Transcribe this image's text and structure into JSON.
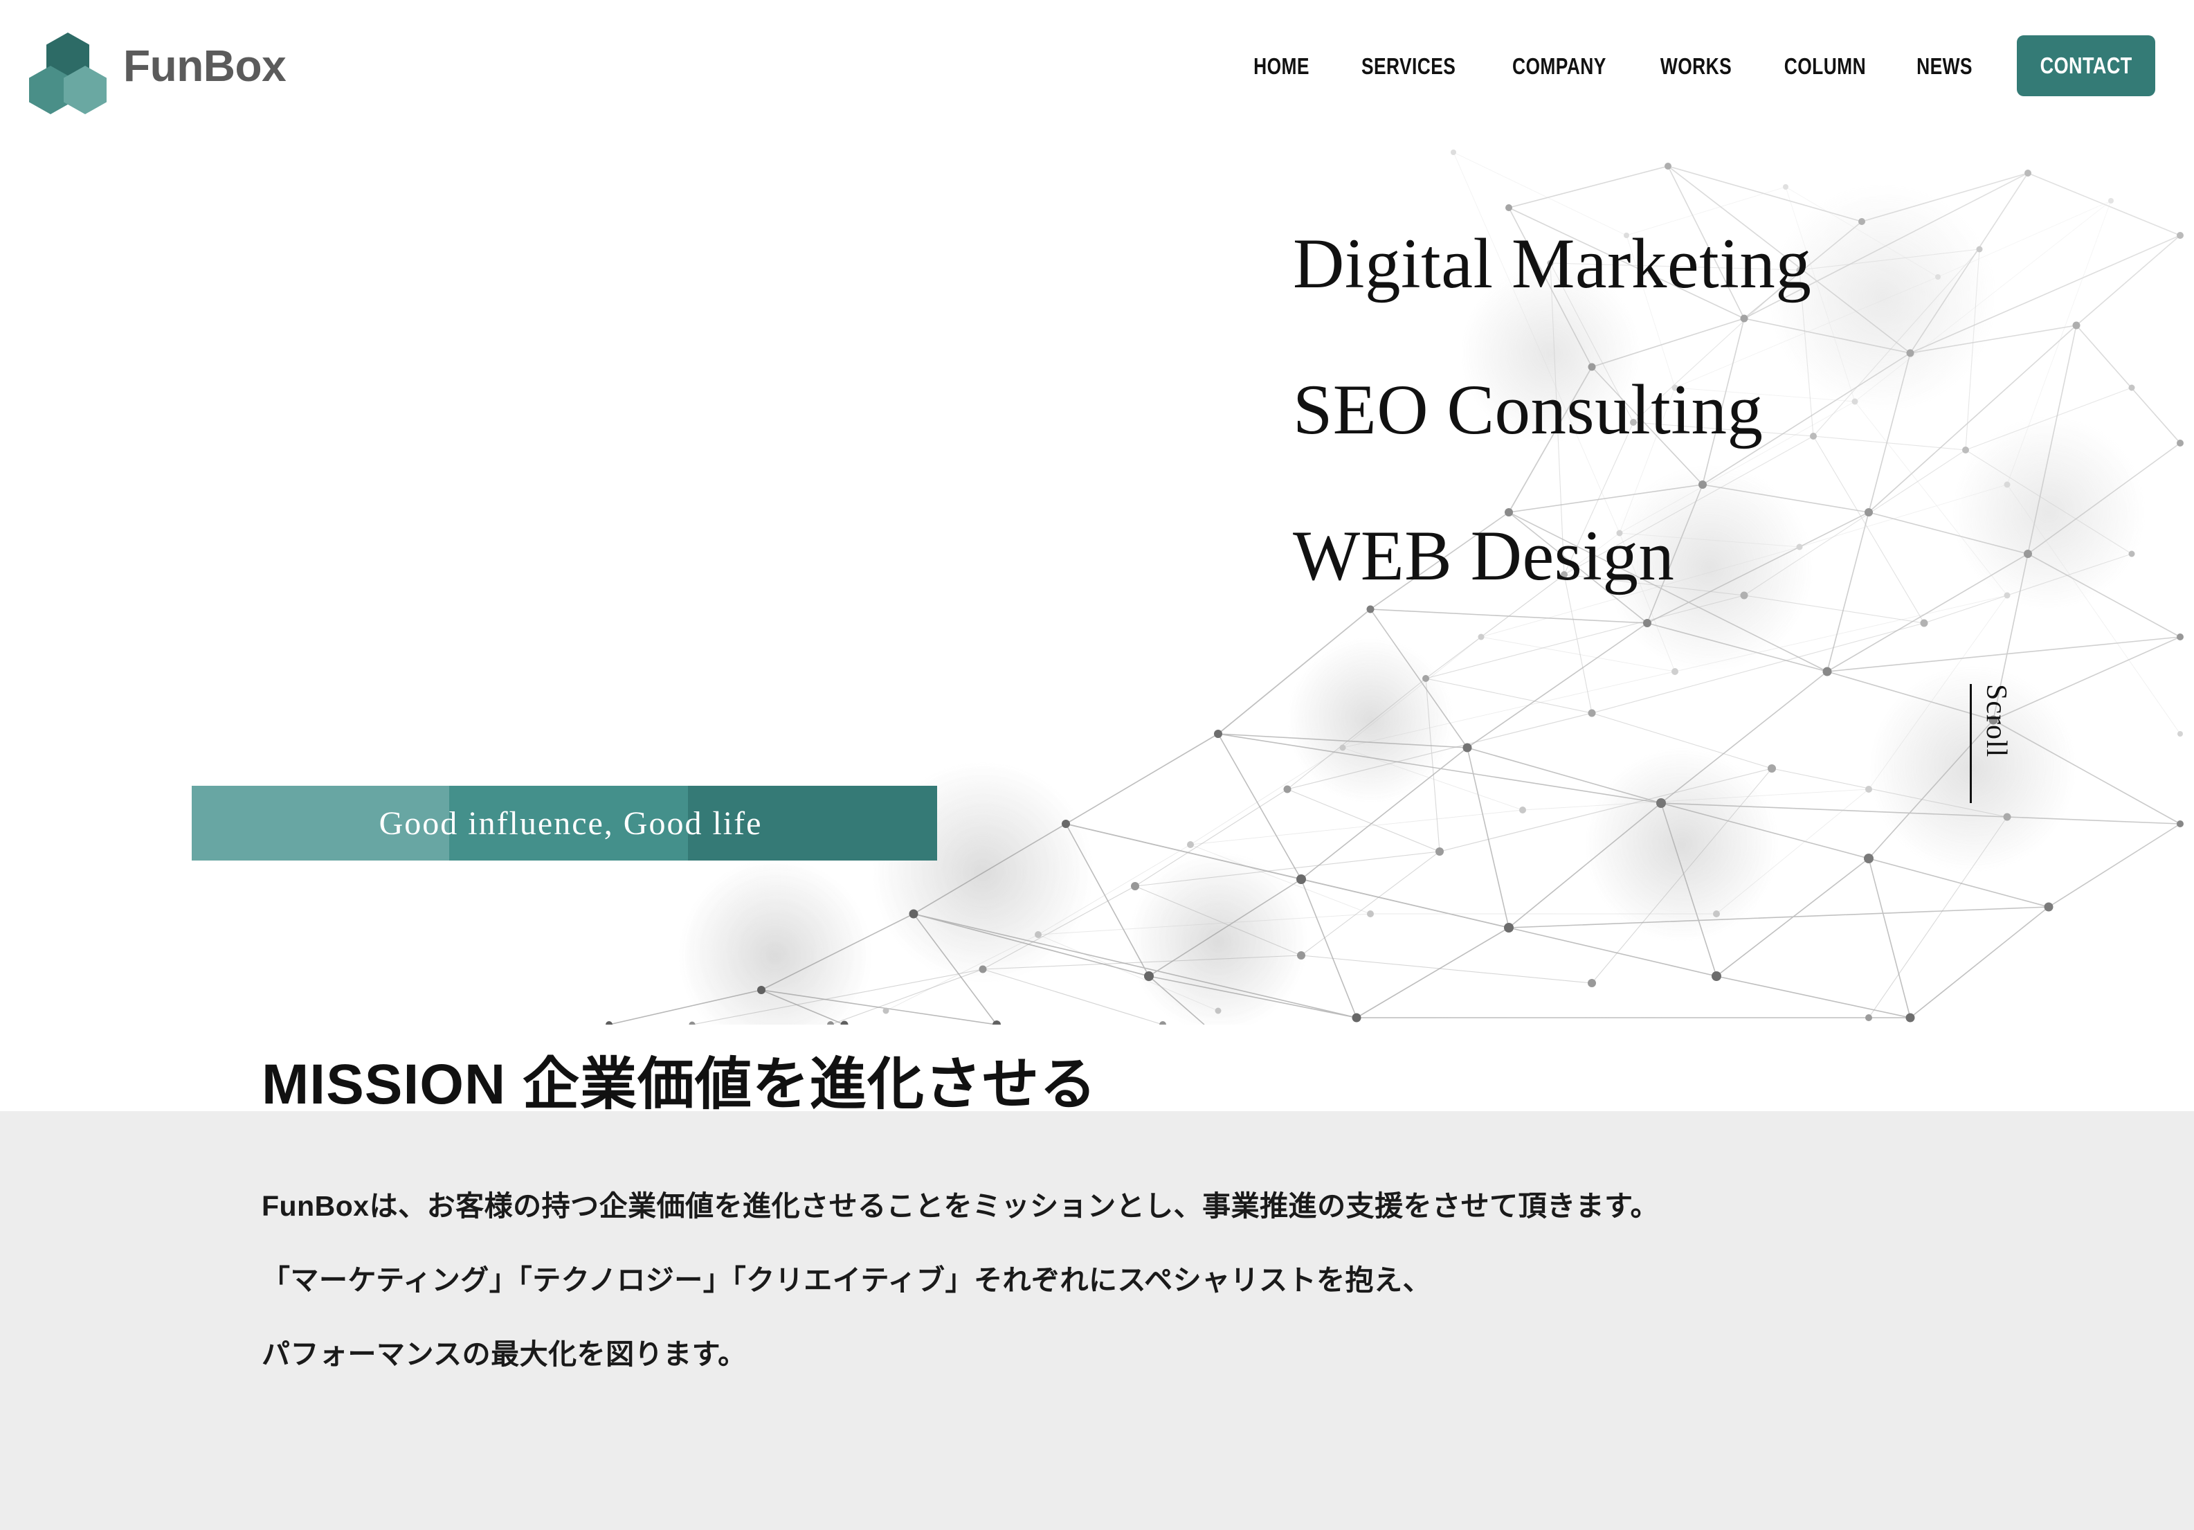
{
  "brand": {
    "name": "FunBox",
    "logo_colors": {
      "top": "#2d6b66",
      "left": "#4a8f88",
      "right": "#6aa8a2"
    }
  },
  "nav": {
    "items": [
      {
        "label": "HOME",
        "name": "nav-item-home"
      },
      {
        "label": "SERVICES",
        "name": "nav-item-services"
      },
      {
        "label": "COMPANY",
        "name": "nav-item-company"
      },
      {
        "label": "WORKS",
        "name": "nav-item-works"
      },
      {
        "label": "COLUMN",
        "name": "nav-item-column"
      },
      {
        "label": "NEWS",
        "name": "nav-item-news"
      }
    ],
    "contact_label": "CONTACT",
    "contact_bg": "#347b76"
  },
  "hero": {
    "lines": [
      "Digital Marketing",
      "SEO Consulting",
      "WEB Design"
    ],
    "tagline": "Good influence,  Good life",
    "tagline_colors": [
      "#68a6a3",
      "#44908b",
      "#357a76"
    ],
    "scroll_label": "Scroll"
  },
  "mission": {
    "title": "MISSION 企業価値を進化させる",
    "paragraphs": [
      "FunBoxは、お客様の持つ企業価値を進化させることをミッションとし、事業推進の支援をさせて頂きます。",
      "「マーケティング」「テクノロジー」「クリエイティブ」それぞれにスペシャリストを抱え、",
      "パフォーマンスの最大化を図ります。"
    ],
    "band_color": "#ededed"
  }
}
